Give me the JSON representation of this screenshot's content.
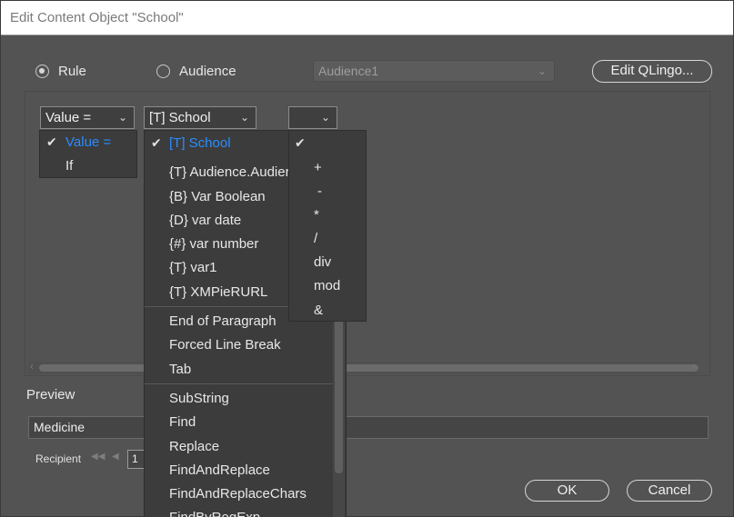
{
  "window": {
    "title": "Edit Content Object \"School\""
  },
  "mode": {
    "rule_label": "Rule",
    "audience_label": "Audience",
    "audience_select": "Audience1",
    "edit_button": "Edit QLingo..."
  },
  "rule": {
    "first_combo": "Value =",
    "first_options": [
      "Value =",
      "If"
    ],
    "second_combo": "[T] School",
    "operator_combo": ""
  },
  "variables": [
    "[T] School",
    "{T} Audience.Audier",
    "{B} Var Boolean",
    "{D} var date",
    "{#} var number",
    "{T} var1",
    "{T} XMPieRURL",
    "End of Paragraph",
    "Forced Line Break",
    "Tab",
    "SubString",
    "Find",
    "Replace",
    "FindAndReplace",
    "FindAndReplaceChars",
    "FindByRegExp"
  ],
  "operators": [
    "",
    "+",
    "-",
    "*",
    "/",
    "div",
    "mod",
    "&"
  ],
  "preview": {
    "label": "Preview",
    "value": "Medicine",
    "recipient_label": "Recipient",
    "recipient_number": "1"
  },
  "buttons": {
    "ok": "OK",
    "cancel": "Cancel"
  },
  "colors": {
    "background": "#535353",
    "selected_item": "#2b8cff",
    "dropdown_bg": "#3c3c3c"
  }
}
